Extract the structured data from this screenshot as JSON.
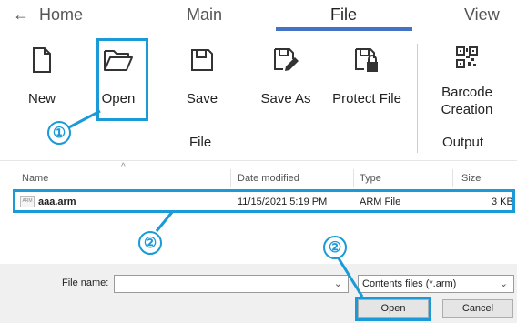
{
  "tabs": {
    "back_arrow": "←",
    "home": "Home",
    "main": "Main",
    "file": "File",
    "view": "View"
  },
  "ribbon": {
    "new": "New",
    "open": "Open",
    "save": "Save",
    "save_as": "Save As",
    "protect_file": "Protect File",
    "barcode_line1": "Barcode",
    "barcode_line2": "Creation",
    "group_file": "File",
    "group_output": "Output"
  },
  "callouts": {
    "one": "①",
    "two": "②"
  },
  "file_list": {
    "headers": [
      "Name",
      "Date modified",
      "Type",
      "Size"
    ],
    "rows": [
      {
        "icon_text": "ARM",
        "name": "aaa.arm",
        "date": "11/15/2021 5:19 PM",
        "type": "ARM File",
        "size": "3 KB"
      }
    ]
  },
  "dialog": {
    "file_name_label": "File name:",
    "file_name_value": "",
    "filter_value": "Contents files (*.arm)",
    "open_button": "Open",
    "cancel_button": "Cancel"
  },
  "colors": {
    "accent": "#4472c4",
    "highlight": "#1a9ad6"
  },
  "icons": [
    "new-document-icon",
    "open-folder-icon",
    "save-disk-icon",
    "save-as-icon",
    "protect-file-icon",
    "qr-code-icon",
    "dropdown-chevron-icon",
    "sort-caret-icon"
  ]
}
